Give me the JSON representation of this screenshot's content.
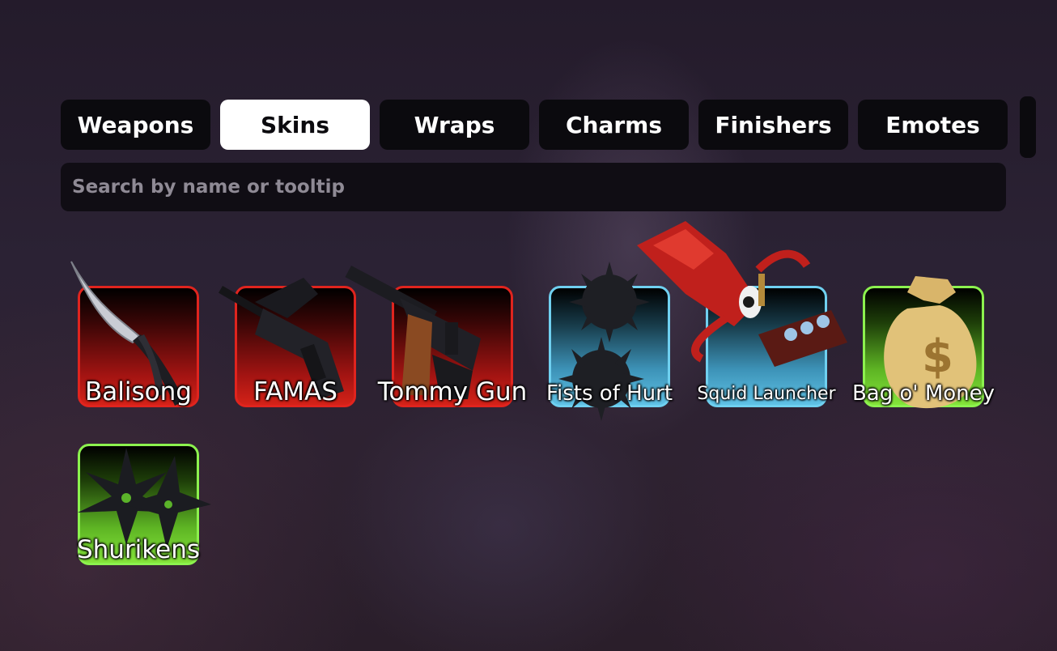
{
  "tabs": [
    {
      "label": "Weapons",
      "active": false
    },
    {
      "label": "Skins",
      "active": true
    },
    {
      "label": "Wraps",
      "active": false
    },
    {
      "label": "Charms",
      "active": false
    },
    {
      "label": "Finishers",
      "active": false
    },
    {
      "label": "Emotes",
      "active": false
    }
  ],
  "search": {
    "placeholder": "Search by name or tooltip"
  },
  "items": [
    {
      "name": "Balisong",
      "rarity": "red",
      "icon": "balisong-icon"
    },
    {
      "name": "FAMAS",
      "rarity": "red",
      "icon": "famas-icon"
    },
    {
      "name": "Tommy Gun",
      "rarity": "red",
      "icon": "tommy-gun-icon"
    },
    {
      "name": "Fists of Hurt",
      "rarity": "blue",
      "icon": "spiked-balls-icon"
    },
    {
      "name": "Squid Launcher",
      "rarity": "blue",
      "icon": "squid-launcher-icon"
    },
    {
      "name": "Bag o' Money",
      "rarity": "green",
      "icon": "money-bag-icon"
    },
    {
      "name": "Shurikens",
      "rarity": "green",
      "icon": "shuriken-icon"
    }
  ],
  "colors": {
    "red": "#e0241e",
    "blue": "#6fd0f0",
    "green": "#8cf24e",
    "tab_bg": "#0b0a0e",
    "tab_active_bg": "#ffffff"
  }
}
